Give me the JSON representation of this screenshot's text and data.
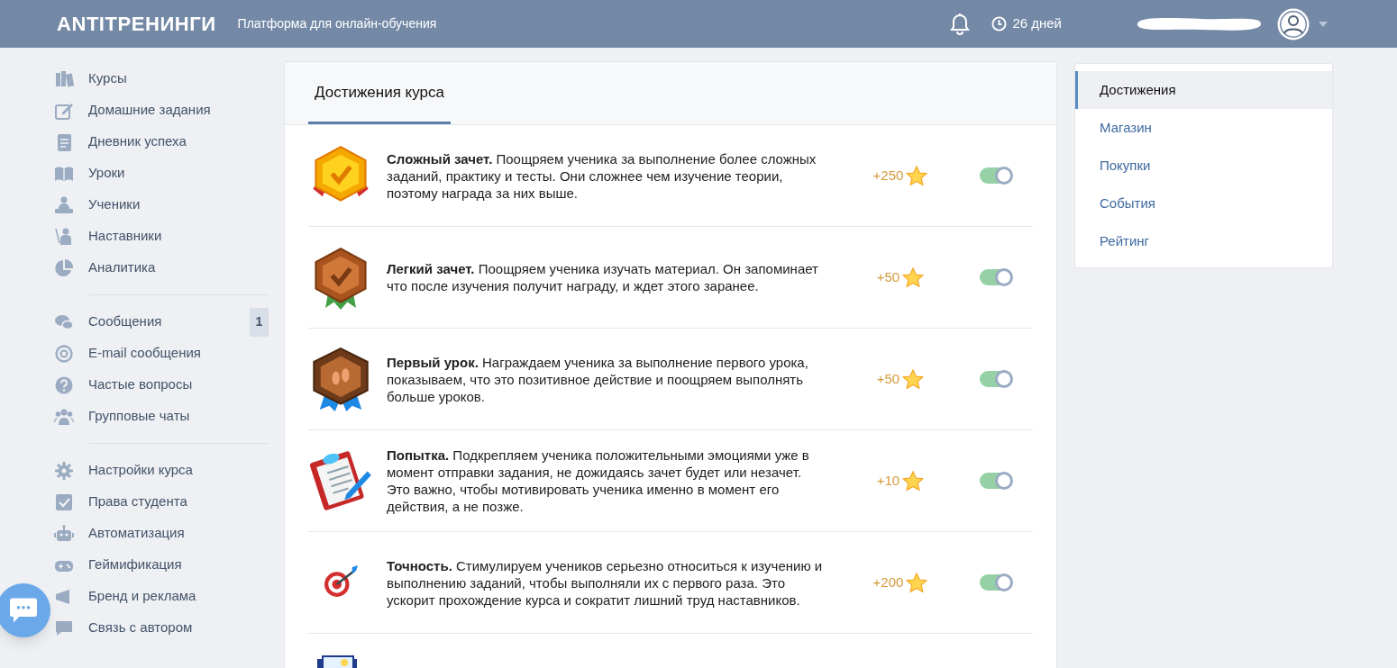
{
  "header": {
    "logo": "ANTITРЕНИНГИ",
    "subtitle": "Платформа для онлайн-обучения",
    "days": "26 дней"
  },
  "sidebar": {
    "groups": [
      [
        {
          "label": "Курсы"
        },
        {
          "label": "Домашние задания"
        },
        {
          "label": "Дневник успеха"
        },
        {
          "label": "Уроки"
        },
        {
          "label": "Ученики"
        },
        {
          "label": "Наставники"
        },
        {
          "label": "Аналитика"
        }
      ],
      [
        {
          "label": "Сообщения",
          "badge": "1"
        },
        {
          "label": "E-mail сообщения"
        },
        {
          "label": "Частые вопросы"
        },
        {
          "label": "Групповые чаты"
        }
      ],
      [
        {
          "label": "Настройки курса"
        },
        {
          "label": "Права студента"
        },
        {
          "label": "Автоматизация"
        },
        {
          "label": "Геймификация"
        },
        {
          "label": "Бренд и реклама"
        },
        {
          "label": "Связь с автором"
        }
      ]
    ]
  },
  "main": {
    "tabs": [
      {
        "label": "Достижения курса",
        "selected": true
      }
    ],
    "achievements": [
      {
        "title": "Сложный зачет.",
        "text": "Поощряем ученика за выполнение более сложных заданий, практику и тесты. Они сложнее чем изучение теории, поэтому награда за них выше.",
        "points": "+250",
        "on": true
      },
      {
        "title": "Легкий зачет.",
        "text": "Поощряем ученика изучать материал. Он запоминает что после изучения получит награду, и ждет этого заранее.",
        "points": "+50",
        "on": true
      },
      {
        "title": "Первый урок.",
        "text": "Награждаем ученика за выполнение первого урока, показываем, что это позитивное действие и поощряем выполнять больше уроков.",
        "points": "+50",
        "on": true
      },
      {
        "title": "Попытка.",
        "text": "Подкрепляем ученика положительными эмоциями уже в момент отправки задания, не дожидаясь зачет будет или незачет. Это важно, чтобы мотивировать ученика именно в момент его действия, а не позже.",
        "points": "+10",
        "on": true
      },
      {
        "title": "Точность.",
        "text": "Стимулируем учеников серьезно относиться к изучению и выполнению заданий, чтобы выполняли их с первого раза. Это ускорит прохождение курса и сократит лишний труд наставников.",
        "points": "+200",
        "on": true
      }
    ]
  },
  "right_menu": [
    {
      "label": "Достижения",
      "selected": true
    },
    {
      "label": "Магазин",
      "selected": false
    },
    {
      "label": "Покупки",
      "selected": false
    },
    {
      "label": "События",
      "selected": false
    },
    {
      "label": "Рейтинг",
      "selected": false
    }
  ]
}
